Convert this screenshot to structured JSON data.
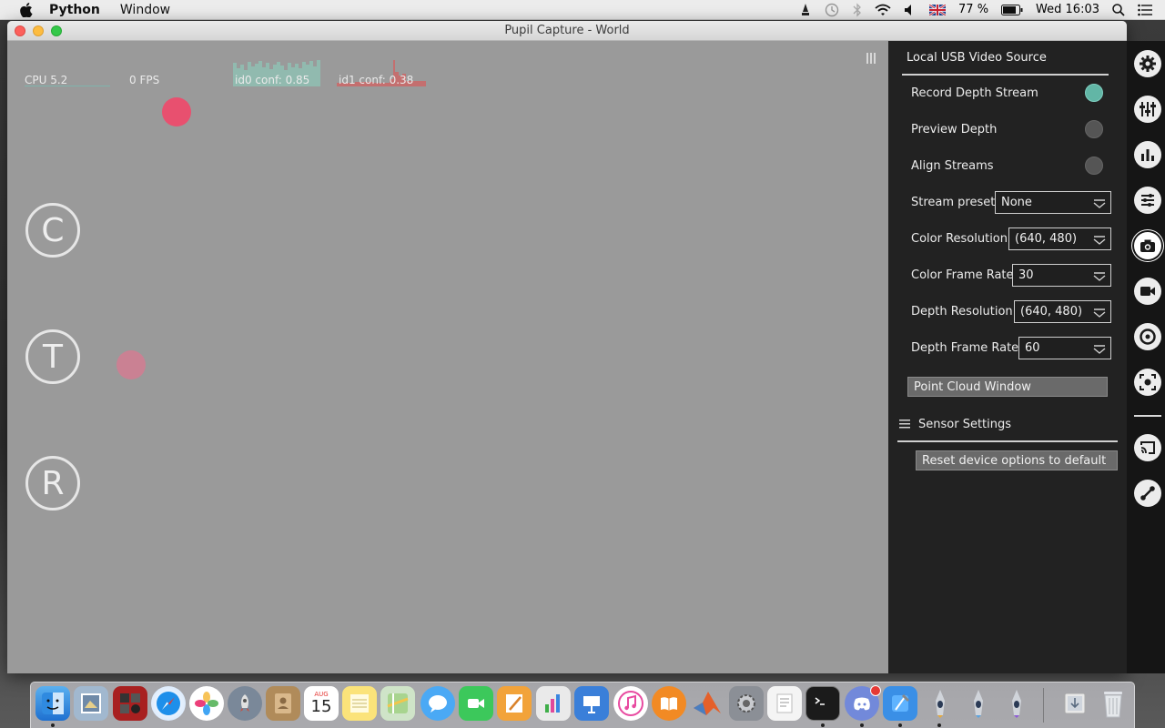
{
  "menubar": {
    "app_name": "Python",
    "menu_window": "Window",
    "battery": "77 %",
    "clock": "Wed 16:03"
  },
  "window": {
    "title": "Pupil Capture - World"
  },
  "world": {
    "cpu_label": "CPU 5.2",
    "fps_label": "0 FPS",
    "id0_label": "id0 conf: 0.85",
    "id1_label": "id1 conf: 0.38",
    "markers": [
      "C",
      "T",
      "R"
    ],
    "colors": {
      "gaze": "#e8506f",
      "id0_graph": "#8fc0b3",
      "id1_graph": "#c96a6a"
    }
  },
  "panel": {
    "title": "Local USB Video Source",
    "toggles": [
      {
        "label": "Record Depth Stream",
        "on": true
      },
      {
        "label": "Preview Depth",
        "on": false
      },
      {
        "label": "Align Streams",
        "on": false
      }
    ],
    "selects": [
      {
        "label": "Stream preset",
        "value": "None"
      },
      {
        "label": "Color Resolution",
        "value": "(640, 480)"
      },
      {
        "label": "Color Frame Rate",
        "value": "30"
      },
      {
        "label": "Depth Resolution",
        "value": "(640, 480)"
      },
      {
        "label": "Depth Frame Rate",
        "value": "60"
      }
    ],
    "point_cloud_button": "Point Cloud Window",
    "sensor_settings": "Sensor Settings",
    "reset_button": "Reset device options to default"
  },
  "iconbar": {
    "icons": [
      "gear-icon",
      "sliders-icon",
      "bar-chart-icon",
      "list-settings-icon",
      "camera-icon",
      "video-camera-icon",
      "target-icon",
      "capture-frame-icon",
      "screen-cast-icon",
      "link-icon"
    ]
  },
  "dock": {
    "apps": [
      "finder",
      "preview",
      "photo-booth",
      "safari",
      "photos",
      "launchpad",
      "contacts",
      "calendar",
      "notes",
      "maps",
      "messages",
      "facetime",
      "pages",
      "numbers",
      "keynote",
      "itunes",
      "ibooks",
      "matlab",
      "system-preferences",
      "textedit",
      "terminal",
      "discord",
      "xcode",
      "pupil-capture",
      "pupil-player",
      "pupil-service",
      "downloads",
      "trash"
    ],
    "calendar_month": "AUG",
    "calendar_day": "15"
  }
}
